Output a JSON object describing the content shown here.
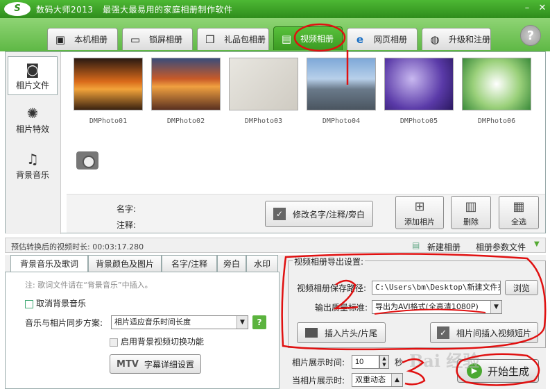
{
  "window": {
    "logo": "S",
    "title": "数码大师2013",
    "subtitle": "最强大最易用的家庭相册制作软件",
    "min": "–",
    "close": "✕"
  },
  "main_tabs": [
    {
      "label": "本机相册",
      "icon": "user-frame-icon"
    },
    {
      "label": "锁屏相册",
      "icon": "monitor-icon"
    },
    {
      "label": "礼品包相册",
      "icon": "gift-icon"
    },
    {
      "label": "视频相册",
      "icon": "film-icon",
      "active": true
    },
    {
      "label": "网页相册",
      "icon": "ie-icon"
    },
    {
      "label": "升级和注册",
      "icon": "globe-icon"
    }
  ],
  "help": "?",
  "sidebar": {
    "items": [
      {
        "label": "相片文件",
        "icon": "camera-icon"
      },
      {
        "label": "相片特效",
        "icon": "effects-icon"
      },
      {
        "label": "背景音乐",
        "icon": "music-icon"
      }
    ]
  },
  "photos": [
    {
      "name": "DMPhoto01"
    },
    {
      "name": "DMPhoto02"
    },
    {
      "name": "DMPhoto03"
    },
    {
      "name": "DMPhoto04"
    },
    {
      "name": "DMPhoto05"
    },
    {
      "name": "DMPhoto06"
    }
  ],
  "info": {
    "name_label": "名字:",
    "note_label": "注释:",
    "edit_button": "修改名字/注释/旁白",
    "add_photo": "添加相片",
    "delete": "删除",
    "select_all": "全选"
  },
  "status": {
    "duration_label": "预估转换后的视频时长: 00:03:17.280",
    "new_album": "新建相册",
    "album_params": "相册参数文件"
  },
  "lower_tabs": [
    {
      "label": "背景音乐及歌词",
      "active": true
    },
    {
      "label": "背景颜色及图片"
    },
    {
      "label": "名字/注释"
    },
    {
      "label": "旁白"
    },
    {
      "label": "水印"
    }
  ],
  "music_panel": {
    "note": "注: 歌词文件请在“背景音乐”中插入。",
    "cancel_music": "取消背景音乐",
    "sync_label": "音乐与相片同步方案:",
    "sync_value": "相片适应音乐时间长度",
    "sync_help": "?",
    "video_switch": "启用背景视频切换功能",
    "mtv_logo": "MTV",
    "subtitle_settings": "字幕详细设置"
  },
  "export": {
    "group_title": "视频相册导出设置:",
    "path_label": "视频相册保存路径:",
    "path_value": "C:\\Users\\bm\\Desktop\\新建文件夹",
    "browse": "浏览",
    "quality_label": "输出质量标准:",
    "quality_value": "导出为AVI格式(全高清1080P)",
    "insert_head": "插入片头/片尾",
    "insert_clip": "相片间插入视频短片"
  },
  "timing": {
    "show_time_label": "相片展示时间:",
    "show_time_value": "10",
    "unit": "秒",
    "transition_label": "当相片展示时:",
    "transition_value": "双重动态"
  },
  "start_button": "开始生成",
  "annotations": {
    "step2": "2",
    "step3": "3"
  },
  "watermark": "Bai 经验"
}
